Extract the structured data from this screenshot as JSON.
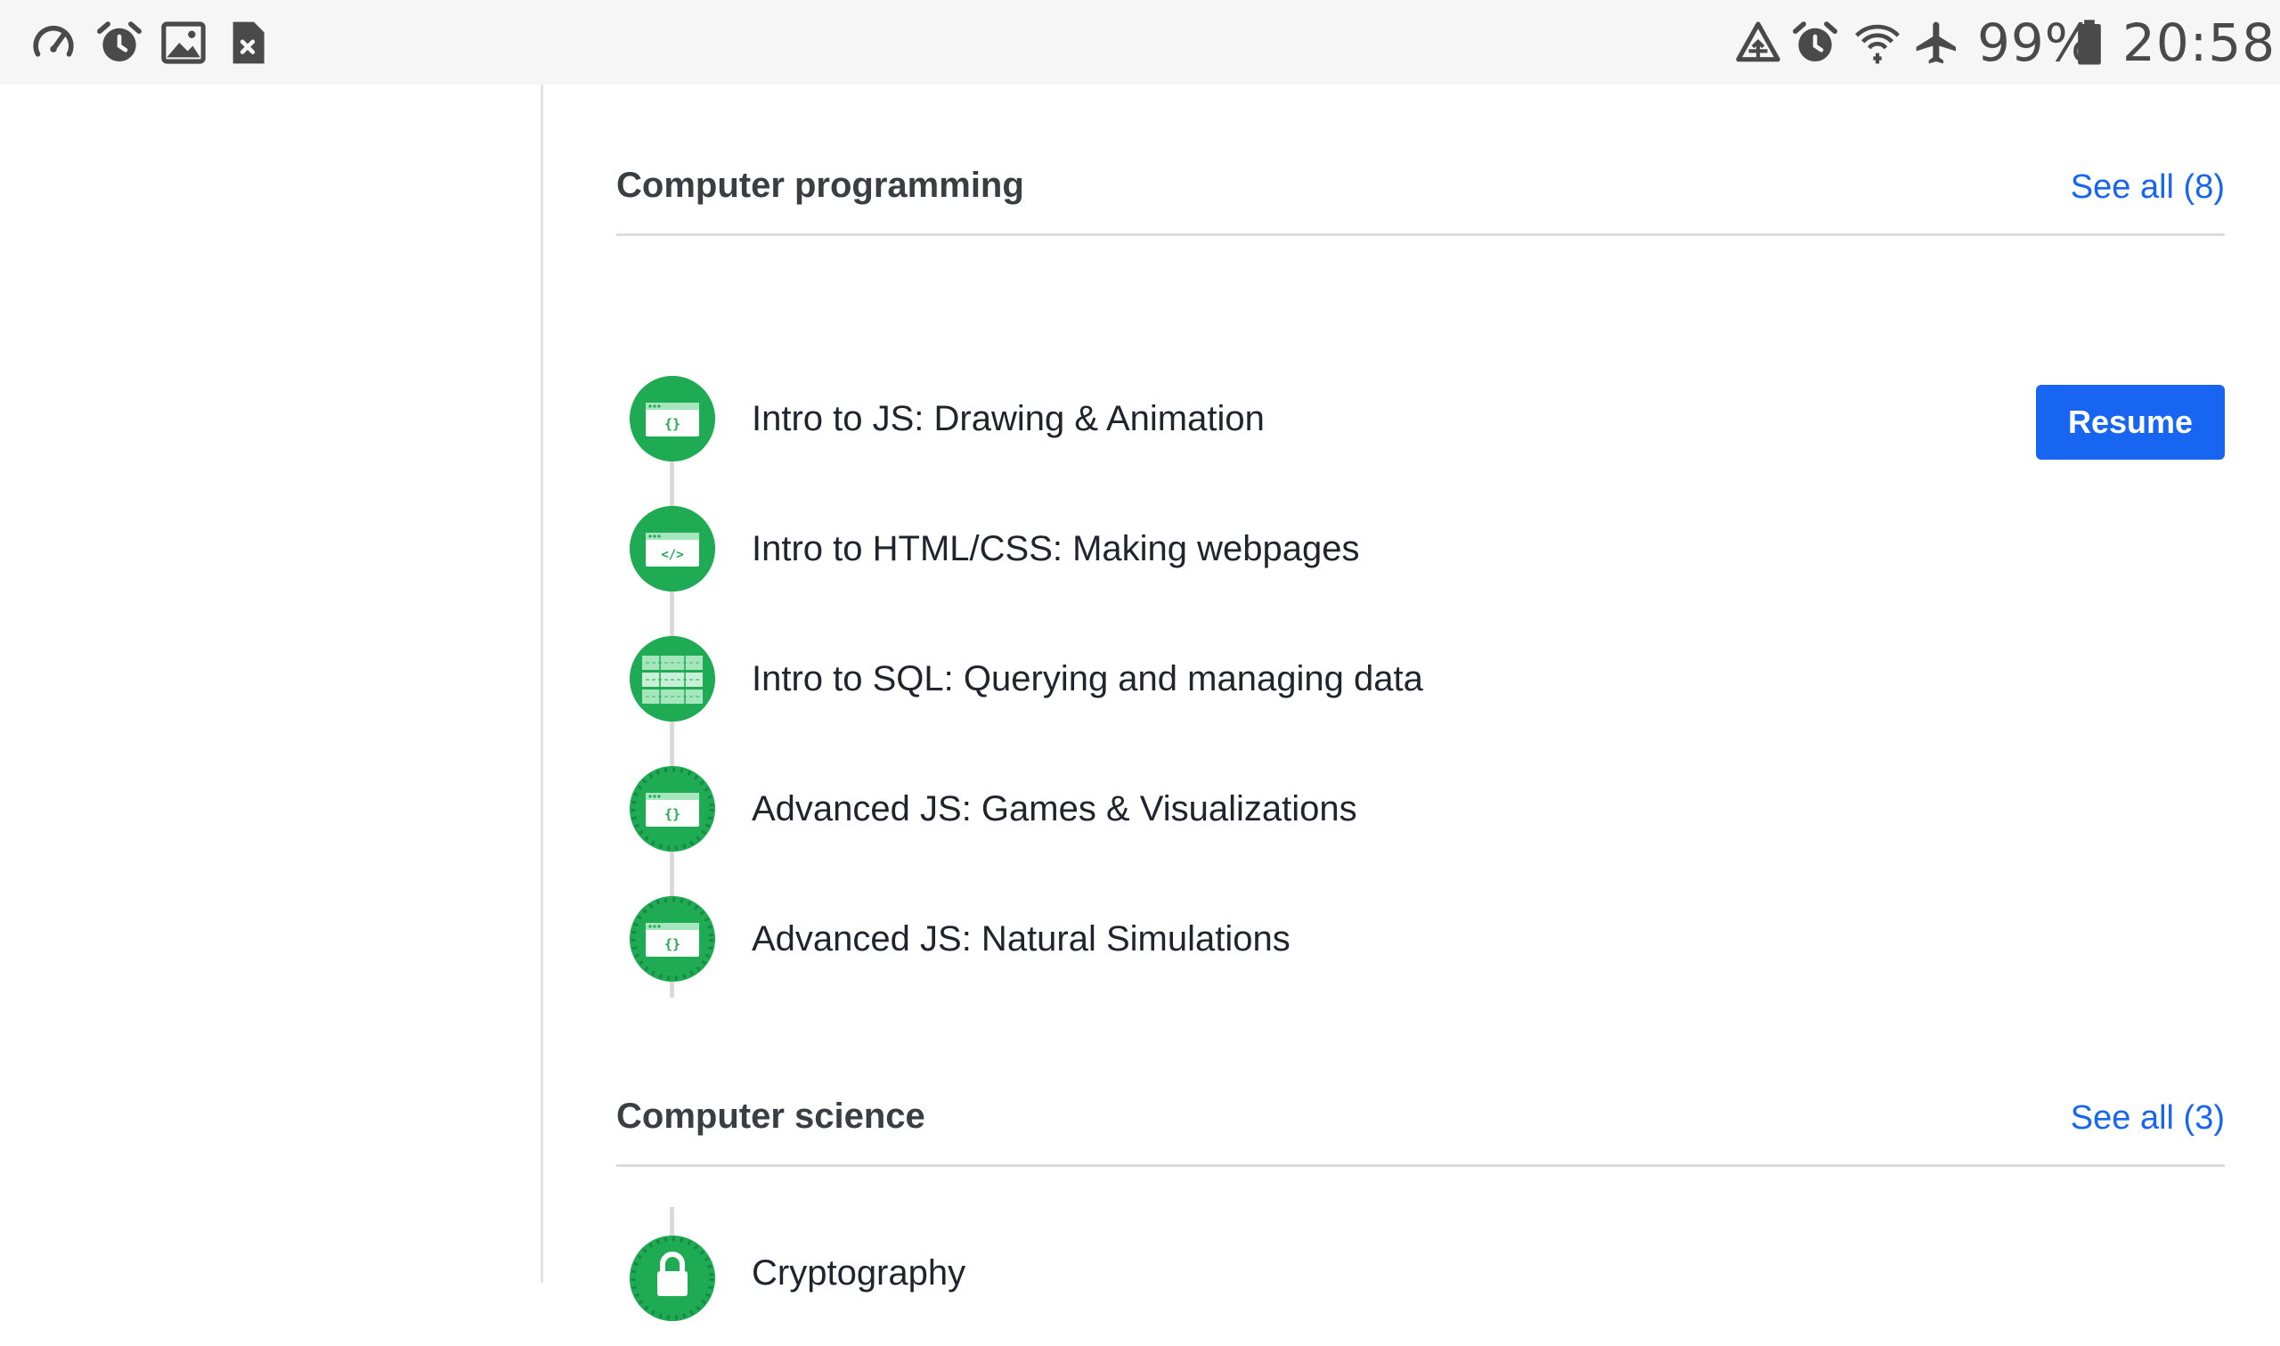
{
  "status_bar": {
    "left_icons": [
      "speedometer-icon",
      "alarm-icon",
      "image-icon",
      "file-close-icon"
    ],
    "right_icons": [
      "data-saver-icon",
      "alarm-icon",
      "wifi-icon",
      "airplane-mode-icon",
      "battery-icon"
    ],
    "battery": "99%",
    "time": "20:58"
  },
  "sections": [
    {
      "title": "Computer programming",
      "see_all": "See all (8)",
      "courses": [
        {
          "title": "Intro to JS: Drawing & Animation",
          "icon": "js-code-window-icon",
          "action": "Resume"
        },
        {
          "title": "Intro to HTML/CSS: Making webpages",
          "icon": "html-code-window-icon"
        },
        {
          "title": "Intro to SQL: Querying and managing data",
          "icon": "sql-table-icon"
        },
        {
          "title": "Advanced JS: Games & Visualizations",
          "icon": "js-code-window-icon"
        },
        {
          "title": "Advanced JS: Natural Simulations",
          "icon": "js-code-window-icon"
        }
      ]
    },
    {
      "title": "Computer science",
      "see_all": "See all (3)",
      "courses": [
        {
          "title": "Cryptography",
          "icon": "lock-icon"
        }
      ]
    }
  ],
  "colors": {
    "accent_blue": "#1865f2",
    "course_green": "#1fab54",
    "status_bar_bg": "#f6f6f6"
  }
}
